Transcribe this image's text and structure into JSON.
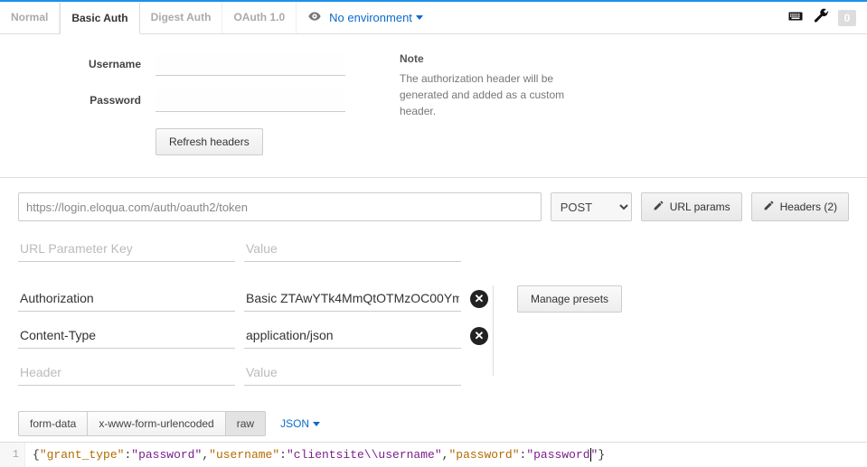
{
  "top": {
    "tabs": [
      "Normal",
      "Basic Auth",
      "Digest Auth",
      "OAuth 1.0"
    ],
    "active_tab_index": 1,
    "environment_label": "No environment",
    "badge": "0"
  },
  "auth": {
    "username_label": "Username",
    "password_label": "Password",
    "refresh_button": "Refresh headers",
    "note_title": "Note",
    "note_body": "The authorization header will be generated and added as a custom header."
  },
  "request": {
    "url": "https://login.eloqua.com/auth/oauth2/token",
    "method": "POST",
    "url_params_btn": "URL params",
    "headers_btn": "Headers (2)"
  },
  "url_params_placeholder": {
    "key": "URL Parameter Key",
    "value": "Value"
  },
  "headers": [
    {
      "key": "Authorization",
      "value": "Basic ZTAwYTk4MmQtOTMzOC00Ym"
    },
    {
      "key": "Content-Type",
      "value": "application/json"
    }
  ],
  "header_placeholder": {
    "key": "Header",
    "value": "Value"
  },
  "presets": {
    "manage_btn": "Manage presets"
  },
  "body_tabs": {
    "items": [
      "form-data",
      "x-www-form-urlencoded",
      "raw"
    ],
    "active_index": 2,
    "format": "JSON"
  },
  "editor": {
    "line_number": "1",
    "json": {
      "k1": "grant_type",
      "v1": "password",
      "k2": "username",
      "v2": "clientsite\\\\username",
      "k3": "password",
      "v3": "password"
    }
  }
}
